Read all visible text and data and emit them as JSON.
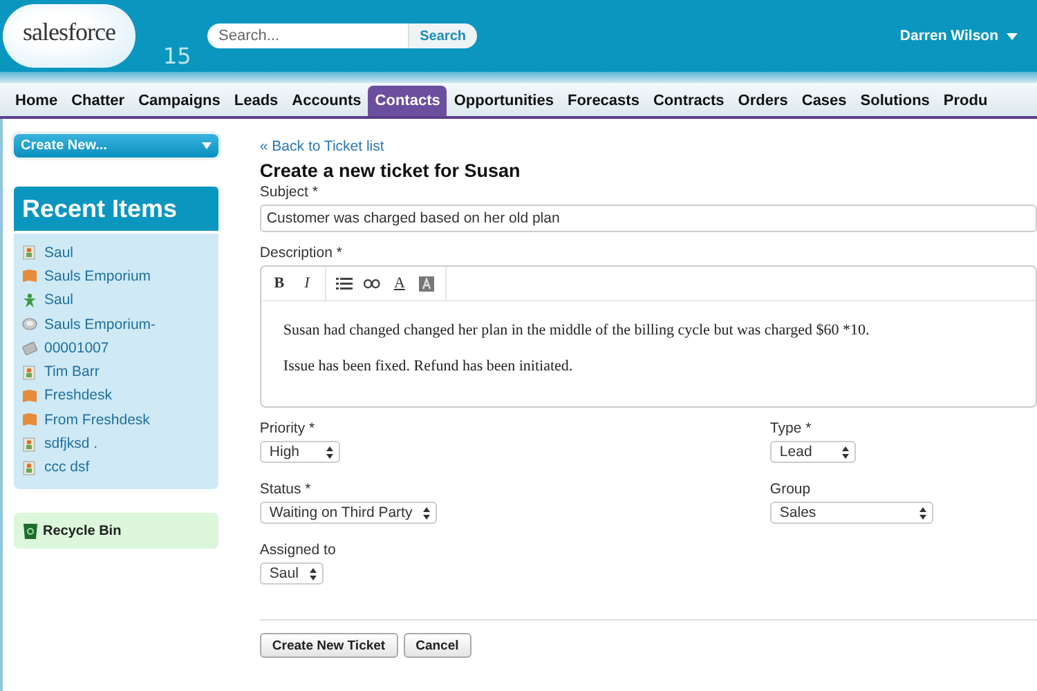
{
  "header": {
    "logo": {
      "wordmark": "salesforce",
      "badge": "15"
    },
    "search": {
      "placeholder": "Search...",
      "button": "Search"
    },
    "user": {
      "name": "Darren Wilson"
    }
  },
  "tabs": [
    {
      "label": "Home",
      "selected": false
    },
    {
      "label": "Chatter",
      "selected": false
    },
    {
      "label": "Campaigns",
      "selected": false
    },
    {
      "label": "Leads",
      "selected": false
    },
    {
      "label": "Accounts",
      "selected": false
    },
    {
      "label": "Contacts",
      "selected": true
    },
    {
      "label": "Opportunities",
      "selected": false
    },
    {
      "label": "Forecasts",
      "selected": false
    },
    {
      "label": "Contracts",
      "selected": false
    },
    {
      "label": "Orders",
      "selected": false
    },
    {
      "label": "Cases",
      "selected": false
    },
    {
      "label": "Solutions",
      "selected": false
    },
    {
      "label": "Produ",
      "selected": false
    }
  ],
  "sidebar": {
    "create_new": "Create New...",
    "recent_title": "Recent Items",
    "recent_items": [
      {
        "kind": "contact",
        "label": "Saul"
      },
      {
        "kind": "account",
        "label": "Sauls Emporium"
      },
      {
        "kind": "lead",
        "label": "Saul"
      },
      {
        "kind": "opportunity",
        "label": "Sauls Emporium-"
      },
      {
        "kind": "case",
        "label": "00001007"
      },
      {
        "kind": "contact",
        "label": "Tim Barr"
      },
      {
        "kind": "account",
        "label": "Freshdesk"
      },
      {
        "kind": "account",
        "label": "From Freshdesk"
      },
      {
        "kind": "contact",
        "label": "sdfjksd ."
      },
      {
        "kind": "contact",
        "label": "ccc dsf"
      }
    ],
    "recycle_bin": "Recycle Bin"
  },
  "form": {
    "back_link": "« Back to Ticket list",
    "title": "Create a new ticket for Susan",
    "subject": {
      "label": "Subject *",
      "value": "Customer was charged based on her old plan"
    },
    "description": {
      "label": "Description *",
      "toolbar": [
        {
          "kind": "bold",
          "label": "B"
        },
        {
          "kind": "italic",
          "label": "I"
        },
        {
          "kind": "list"
        },
        {
          "kind": "link"
        },
        {
          "kind": "text-color",
          "label": "A"
        },
        {
          "kind": "bg-color"
        }
      ],
      "paragraphs": [
        "Susan had changed changed her plan in the middle of the billing cycle but was charged $60 *10.",
        "Issue has been fixed. Refund has been initiated."
      ]
    },
    "selects": [
      {
        "label": "Priority *",
        "value": "High"
      },
      {
        "label": "Type *",
        "value": "Lead"
      },
      {
        "label": "Status *",
        "value": "Waiting on Third Party"
      },
      {
        "label": "Group",
        "value": "Sales"
      },
      {
        "label": "Assigned to",
        "value": "Saul"
      }
    ],
    "buttons": [
      "Create New Ticket",
      "Cancel"
    ]
  }
}
